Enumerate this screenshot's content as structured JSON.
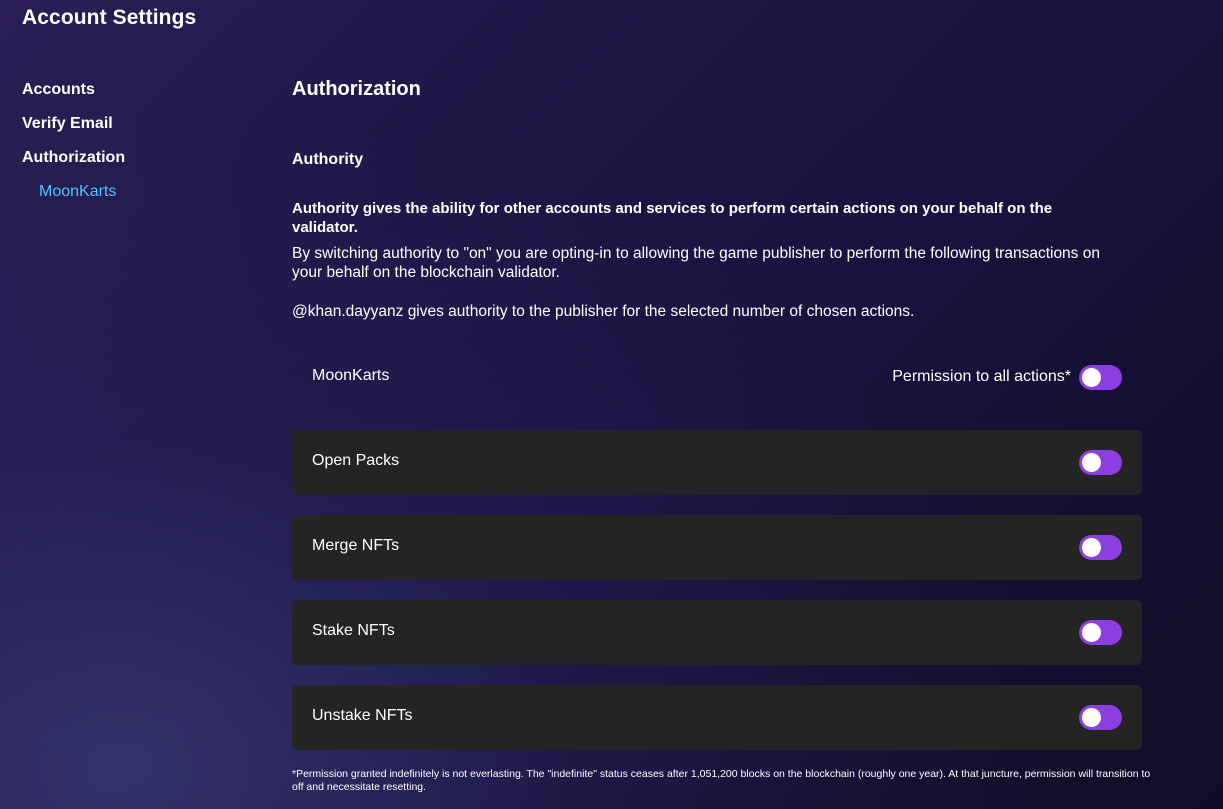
{
  "page": {
    "title": "Account Settings"
  },
  "sidebar": {
    "items": [
      {
        "label": "Accounts"
      },
      {
        "label": "Verify Email"
      },
      {
        "label": "Authorization"
      }
    ],
    "subitems": [
      {
        "label": "MoonKarts"
      }
    ]
  },
  "main": {
    "section_title": "Authorization",
    "subsection_title": "Authority",
    "description_bold": "Authority gives the ability for other accounts and services to perform certain actions on your behalf on the validator.",
    "description": "By switching authority to \"on\" you are opting-in to allowing the game publisher to perform the following transactions on your behalf on the blockchain validator.",
    "user_statement": "@khan.dayyanz gives authority to the publisher for the selected number of chosen actions.",
    "game": {
      "name": "MoonKarts",
      "all_permission_label": "Permission to all actions*",
      "all_permission_on": false
    },
    "actions": [
      {
        "label": "Open Packs",
        "enabled": false
      },
      {
        "label": "Merge NFTs",
        "enabled": false
      },
      {
        "label": "Stake NFTs",
        "enabled": false
      },
      {
        "label": "Unstake NFTs",
        "enabled": false
      }
    ],
    "footnote": "*Permission granted indefinitely is not everlasting. The \"indefinite\" status ceases after 1,051,200 blocks on the blockchain (roughly one year). At that juncture, permission will transition to off and necessitate resetting."
  },
  "colors": {
    "accent": "#8d3ee0",
    "link": "#49c6ff",
    "card": "#242424",
    "background_start": "#2a1f55",
    "background_end": "#130c29"
  }
}
